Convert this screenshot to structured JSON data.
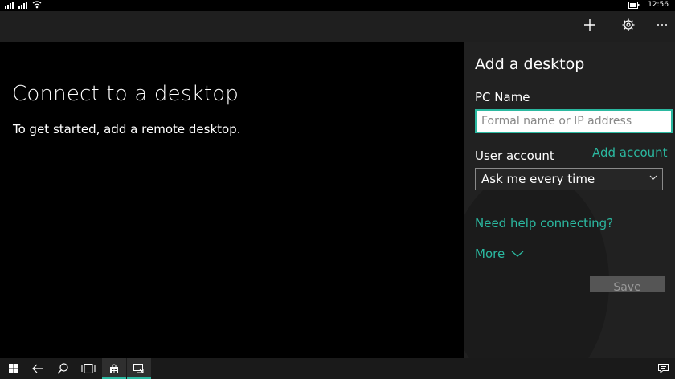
{
  "status": {
    "time": "12:56"
  },
  "appbar": {
    "icons": [
      "add-icon",
      "settings-gear-icon",
      "more-ellipsis-icon"
    ]
  },
  "main": {
    "title": "Connect to a desktop",
    "subtitle": "To get started, add a remote desktop."
  },
  "panel": {
    "title": "Add a desktop",
    "pc_name_label": "PC Name",
    "pc_name_placeholder": "Formal name or IP address",
    "pc_name_value": "",
    "user_account_label": "User account",
    "add_account_link": "Add account",
    "user_account_selected": "Ask me every time",
    "help_link": "Need help connecting?",
    "more_label": "More",
    "save_label": "Save"
  },
  "colors": {
    "accent": "#2bb8a0",
    "panel_bg": "#212121",
    "appbar_bg": "#1f1f1f"
  },
  "taskbar": {
    "items": [
      "windows-start-icon",
      "back-arrow-icon",
      "search-icon",
      "task-view-icon",
      "store-icon",
      "remote-desktop-app-icon"
    ],
    "notification_icon": "action-center-icon"
  }
}
